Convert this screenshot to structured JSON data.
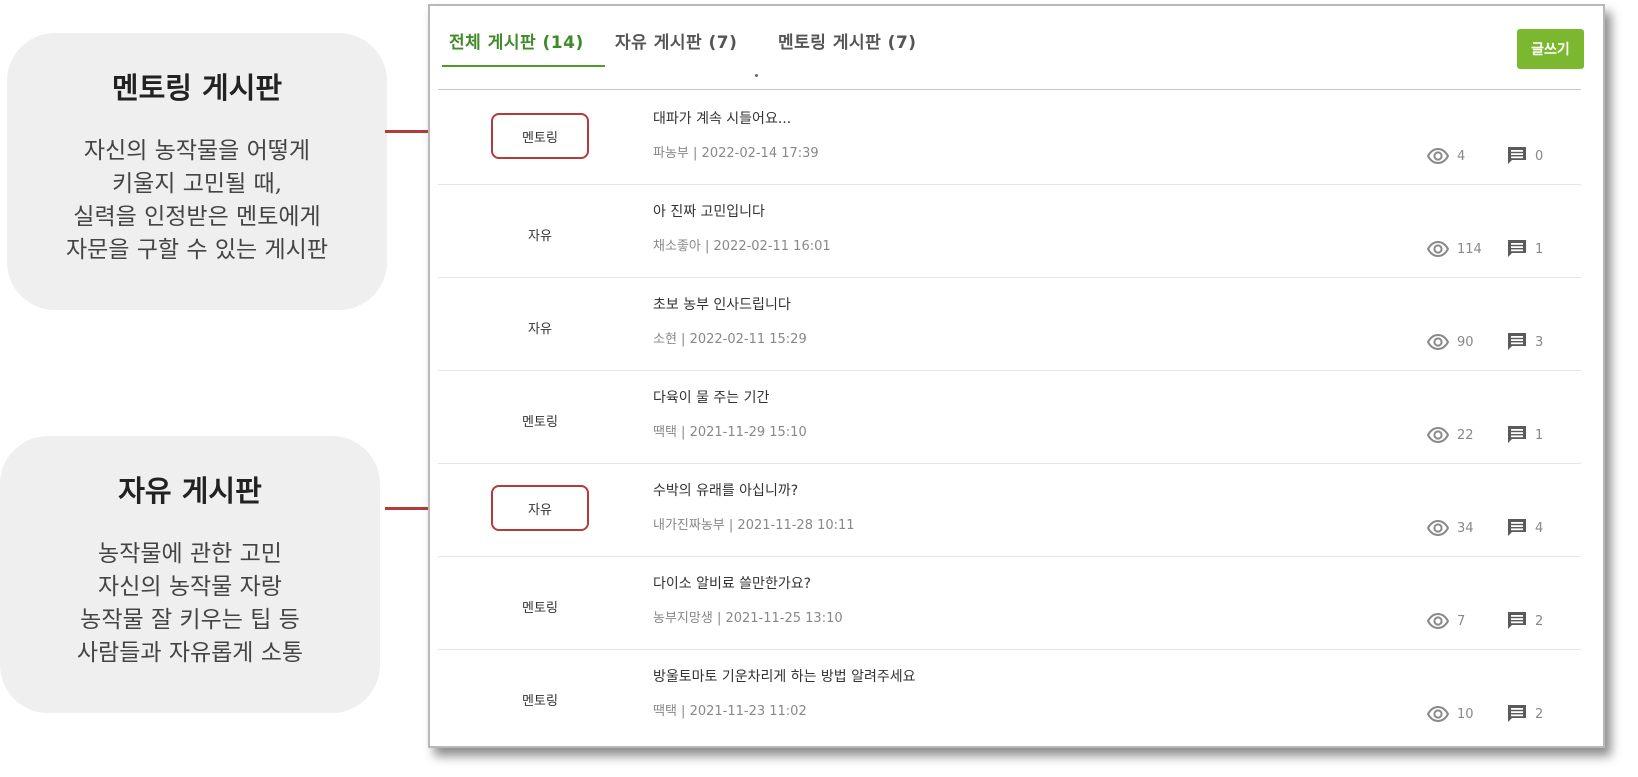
{
  "callouts": [
    {
      "title": "멘토링 게시판",
      "lines": [
        "자신의 농작물을 어떻게",
        "키울지 고민될 때,",
        "실력을 인정받은 멘토에게",
        "자문을 구할 수 있는 게시판"
      ]
    },
    {
      "title": "자유 게시판",
      "lines": [
        "농작물에 관한 고민",
        "자신의 농작물 자랑",
        "농작물 잘 키우는 팁 등",
        "사람들과 자유롭게 소통"
      ]
    }
  ],
  "tabs": [
    {
      "label": "전체 게시판 (14)",
      "active": true
    },
    {
      "label": "자유 게시판 (7)",
      "active": false
    },
    {
      "label": "멘토링 게시판 (7)",
      "active": false
    }
  ],
  "write_button": "글쓰기",
  "colors": {
    "accent": "#7cb82f",
    "active_tab": "#3f8a2a",
    "highlight": "#b53a3a"
  },
  "posts": [
    {
      "category": "멘토링",
      "title": "대파가 계속 시들어요...",
      "author": "파농부",
      "date": "2022-02-14 17:39",
      "views": "4",
      "comments": "0",
      "highlighted": true
    },
    {
      "category": "자유",
      "title": "아 진짜 고민입니다",
      "author": "채소좋아",
      "date": "2022-02-11 16:01",
      "views": "114",
      "comments": "1",
      "highlighted": false
    },
    {
      "category": "자유",
      "title": "초보 농부 인사드립니다",
      "author": "소현",
      "date": "2022-02-11 15:29",
      "views": "90",
      "comments": "3",
      "highlighted": false
    },
    {
      "category": "멘토링",
      "title": "다육이 물 주는 기간",
      "author": "땍택",
      "date": "2021-11-29 15:10",
      "views": "22",
      "comments": "1",
      "highlighted": false
    },
    {
      "category": "자유",
      "title": "수박의 유래를 아십니까?",
      "author": "내가진짜농부",
      "date": "2021-11-28 10:11",
      "views": "34",
      "comments": "4",
      "highlighted": true
    },
    {
      "category": "멘토링",
      "title": "다이소 알비료 쓸만한가요?",
      "author": "농부지망생",
      "date": "2021-11-25 13:10",
      "views": "7",
      "comments": "2",
      "highlighted": false
    },
    {
      "category": "멘토링",
      "title": "방울토마토 기운차리게 하는 방법 알려주세요",
      "author": "땍택",
      "date": "2021-11-23 11:02",
      "views": "10",
      "comments": "2",
      "highlighted": false
    }
  ]
}
